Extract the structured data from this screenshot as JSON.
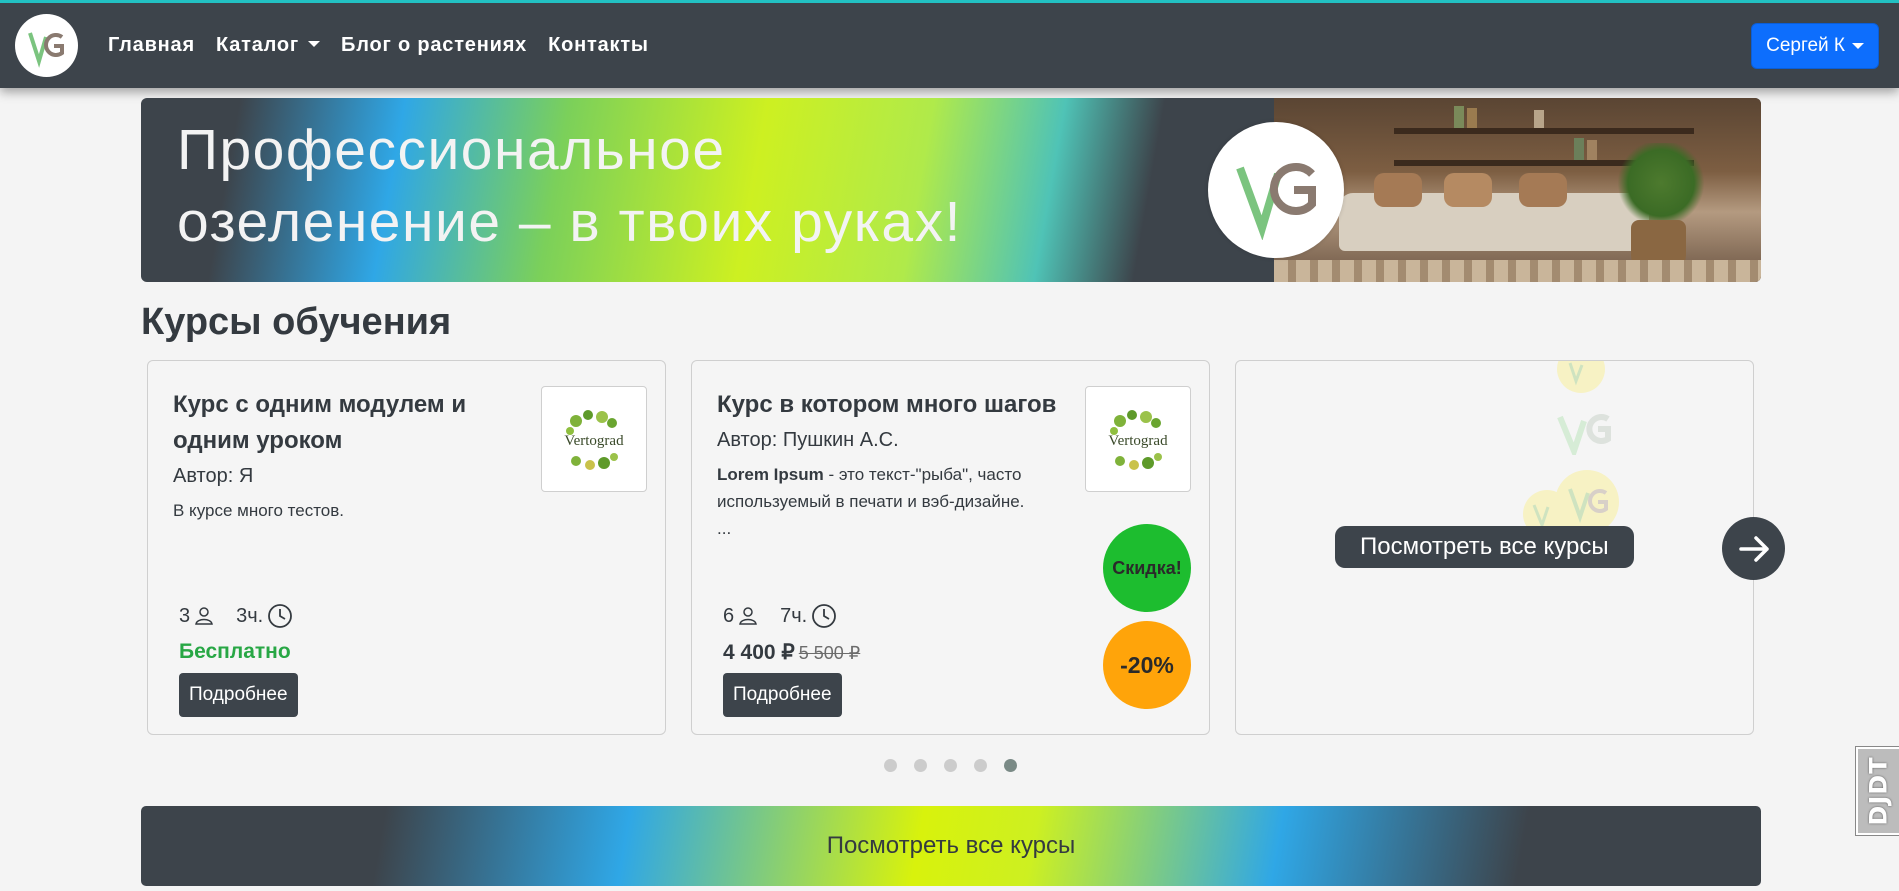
{
  "nav": {
    "logo": "VG",
    "links": [
      "Главная",
      "Каталог",
      "Блог о растениях",
      "Контакты"
    ],
    "user": "Сергей К"
  },
  "banner": {
    "line1": "Профессиональное",
    "line2": "озеленение – в твоих руках!",
    "logo": "VG"
  },
  "section_title": "Курсы обучения",
  "cards": [
    {
      "title": "Курс с одним модулем и одним уроком",
      "author": "Автор: Я",
      "description": "В курсе много тестов.",
      "thumb_text": "Vertograd",
      "students": "3",
      "duration": "3ч.",
      "price_label": "Бесплатно",
      "button": "Подробнее"
    },
    {
      "title": "Курс в котором много шагов",
      "author": "Автор: Пушкин А.С.",
      "description_bold": "Lorem Ipsum",
      "description": " - это текст-\"рыба\", часто используемый в печати и вэб-дизайне. ...",
      "thumb_text": "Vertograd",
      "students": "6",
      "duration": "7ч.",
      "price": "4 400 ₽",
      "old_price": "5 500 ₽",
      "sale_badge": "Скидка!",
      "discount_badge": "-20%",
      "button": "Подробнее"
    }
  ],
  "view_all_card": {
    "button": "Посмотреть все курсы"
  },
  "carousel": {
    "dots": 5,
    "active_index": 4
  },
  "bottom_button": "Посмотреть все курсы",
  "djdt": "DJDT",
  "colors": {
    "navbar": "#3d444b",
    "user_button": "#0d6efd",
    "free": "#28a745",
    "sale_badge": "#1dbd2f",
    "discount_badge": "#ffa40a"
  }
}
